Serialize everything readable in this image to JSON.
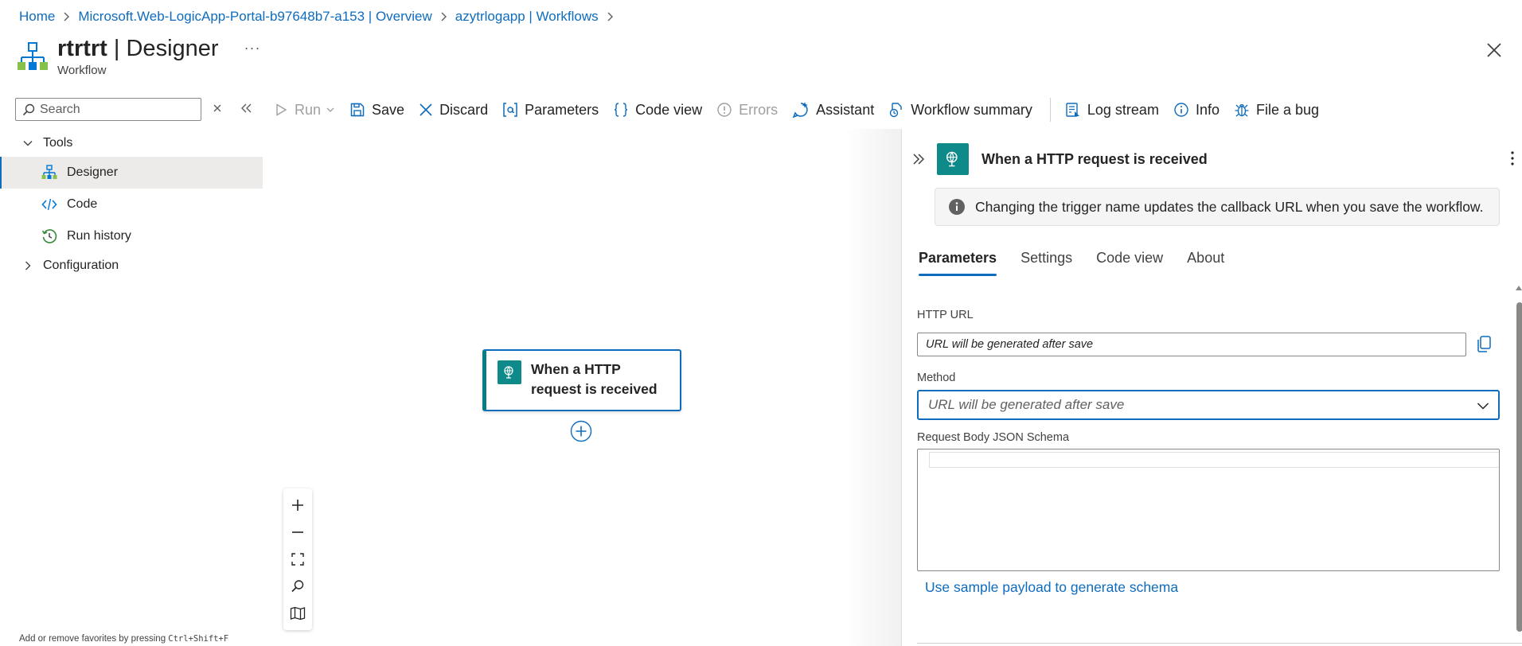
{
  "breadcrumb": [
    {
      "label": "Home"
    },
    {
      "label": "Microsoft.Web-LogicApp-Portal-b97648b7-a153 | Overview"
    },
    {
      "label": "azytrlogapp | Workflows"
    }
  ],
  "header": {
    "title_bold": "rtrtrt",
    "title_rest": " | Designer",
    "subtitle": "Workflow",
    "more_label": "···"
  },
  "sidebar": {
    "search_placeholder": "Search",
    "groups": [
      {
        "label": "Tools",
        "expanded": true,
        "items": [
          {
            "label": "Designer",
            "icon": "designer-icon",
            "active": true
          },
          {
            "label": "Code",
            "icon": "code-icon"
          },
          {
            "label": "Run history",
            "icon": "history-icon"
          }
        ]
      },
      {
        "label": "Configuration",
        "expanded": false
      }
    ],
    "favorites_hint": "Add or remove favorites by pressing ",
    "favorites_shortcut": "Ctrl+Shift+F"
  },
  "toolbar": {
    "run": "Run",
    "save": "Save",
    "discard": "Discard",
    "parameters": "Parameters",
    "code_view": "Code view",
    "errors": "Errors",
    "assistant": "Assistant",
    "workflow_summary": "Workflow summary",
    "log_stream": "Log stream",
    "info": "Info",
    "file_bug": "File a bug"
  },
  "canvas": {
    "node_title": "When a HTTP request is received"
  },
  "panel": {
    "title": "When a HTTP request is received",
    "info_message": "Changing the trigger name updates the callback URL when you save the workflow.",
    "tabs": [
      "Parameters",
      "Settings",
      "Code view",
      "About"
    ],
    "active_tab": "Parameters",
    "http_url_label": "HTTP URL",
    "http_url_value": "URL will be generated after save",
    "method_label": "Method",
    "method_value": "URL will be generated after save",
    "schema_label": "Request Body JSON Schema",
    "sample_link": "Use sample payload to generate schema"
  },
  "colors": {
    "accent": "#0f6cbd",
    "trigger_teal": "#0e8a8a"
  }
}
